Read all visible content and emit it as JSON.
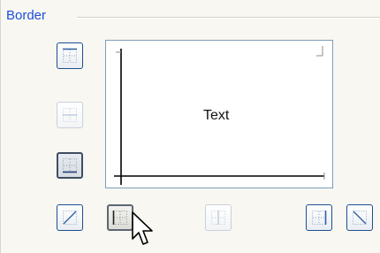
{
  "border_group": {
    "title": "Border"
  },
  "preview": {
    "text": "Text",
    "line_color": "#000000",
    "mark_color": "#8d8d8d"
  },
  "buttons": {
    "top": {
      "state": "normal"
    },
    "inside_horizontal": {
      "state": "disabled"
    },
    "bottom": {
      "state": "pressed"
    },
    "diagonal_up": {
      "state": "normal"
    },
    "left": {
      "state": "pressed-hover"
    },
    "inside_vertical": {
      "state": "disabled"
    },
    "right": {
      "state": "normal"
    },
    "diagonal_down": {
      "state": "normal"
    }
  },
  "colors": {
    "group_title": "#1f4ed8",
    "button_border": "#1a4f92",
    "preview_border": "#7f9db9",
    "icon_line": "#2f5fa5",
    "icon_dots": "#8aa1c4"
  },
  "cursor": {
    "icon": "arrow-pointer-icon"
  }
}
